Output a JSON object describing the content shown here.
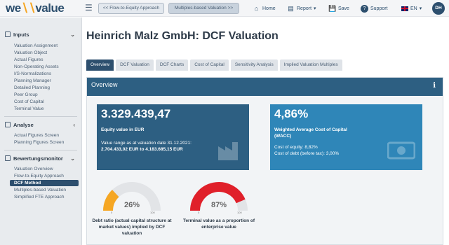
{
  "logo": {
    "prefix": "we",
    "accent": "∖∖",
    "suffix": "value"
  },
  "header": {
    "breadcrumbs": [
      "<< Flow-to-Equity Approach",
      "Multiples-based Valuation >>"
    ],
    "nav": {
      "home": "Home",
      "report": "Report",
      "save": "Save",
      "support": "Support",
      "lang": "EN"
    },
    "avatar": "DH"
  },
  "sidebar": {
    "sections": [
      {
        "title": "Inputs",
        "items": [
          "Valuation Assignment",
          "Valuation Object",
          "Actual Figures",
          "Non-Operating Assets",
          "I/S-Normalizations",
          "Planning Manager",
          "Detailed Planning",
          "Peer Group",
          "Cost of Capital",
          "Terminal Value"
        ]
      },
      {
        "title": "Analyse",
        "items": [
          "Actual Figures Screen",
          "Planning Figures Screen"
        ]
      },
      {
        "title": "Bewertungsmonitor",
        "items": [
          "Valuation Overview",
          "Flow-to-Equity Approach",
          "DCF Method",
          "Multiples-based Valuation",
          "Simplified FTE Approach"
        ]
      }
    ],
    "active_item": "DCF Method"
  },
  "main": {
    "title": "Heinrich Malz GmbH: DCF Valuation",
    "tabs": [
      "Overview",
      "DCF Valuation",
      "DCF Charts",
      "Cost of Capital",
      "Sensitivity Analysis",
      "Implied Valuation Multiples"
    ],
    "active_tab": "Overview",
    "panel_title": "Overview",
    "equity_card": {
      "value": "3.329.439,47",
      "label": "Equity value in EUR",
      "range_label": "Value range as at valuation date 31.12.2021:",
      "range_value": "2.704.433,02 EUR to 4.183.685,15 EUR"
    },
    "wacc_card": {
      "value": "4,86%",
      "label": "Weighted Average Cost of Capital (WACC)",
      "equity_line": "Cost of equity: 8,82%",
      "debt_line": "Cost of debt (before tax): 3,00%"
    },
    "gauges": [
      {
        "percent": 26,
        "display": "26%",
        "min": "0",
        "max": "100",
        "color": "#f5a623",
        "caption": "Debt ratio (actual capital structure at market values) implied by DCF valuation"
      },
      {
        "percent": 87,
        "display": "87%",
        "min": "0",
        "max": "100",
        "color": "#e0202a",
        "caption": "Terminal value as a proportion of enterprise value"
      }
    ]
  },
  "colors": {
    "primary": "#2d4f6e",
    "panel_header": "#2d5f82",
    "wacc_card": "#2f86b8"
  }
}
